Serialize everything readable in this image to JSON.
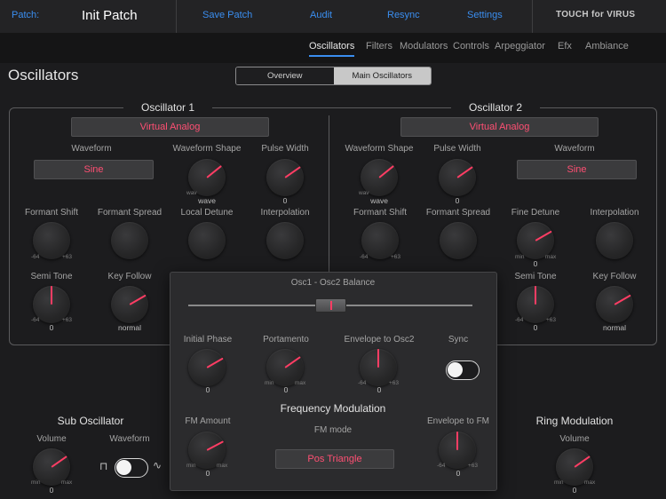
{
  "header": {
    "patch_label": "Patch:",
    "patch_name": "Init Patch",
    "save_patch": "Save Patch",
    "audit": "Audit",
    "resync": "Resync",
    "settings": "Settings",
    "brand": "TOUCH for VIRUS"
  },
  "tabs": [
    "Oscillators",
    "Filters",
    "Modulators",
    "Controls",
    "Arpeggiator",
    "Efx",
    "Ambiance"
  ],
  "page_title": "Oscillators",
  "segmented": {
    "left": "Overview",
    "right": "Main Oscillators",
    "selected": "Main Oscillators"
  },
  "osc1": {
    "title": "Oscillator 1",
    "model": "Virtual Analog",
    "waveform_label": "Waveform",
    "waveform_value": "Sine",
    "wave_shape_label": "Waveform Shape",
    "wave_shape_value": "wave",
    "pulse_width_label": "Pulse Width",
    "pulse_width_value": "0",
    "formant_shift_label": "Formant Shift",
    "formant_spread_label": "Formant Spread",
    "local_detune_label": "Local Detune",
    "interpolation_label": "Interpolation",
    "semi_tone_label": "Semi Tone",
    "semi_tone_value": "0",
    "key_follow_label": "Key Follow",
    "key_follow_value": "normal"
  },
  "osc2": {
    "title": "Oscillator 2",
    "model": "Virtual Analog",
    "wave_shape_label": "Waveform Shape",
    "wave_shape_value": "wave",
    "pulse_width_label": "Pulse Width",
    "pulse_width_value": "0",
    "waveform_label": "Waveform",
    "waveform_value": "Sine",
    "formant_shift_label": "Formant Shift",
    "formant_spread_label": "Formant Spread",
    "fine_detune_label": "Fine Detune",
    "fine_detune_value": "0",
    "interpolation_label": "Interpolation",
    "semi_tone_label": "Semi Tone",
    "semi_tone_value": "0",
    "key_follow_label": "Key Follow",
    "key_follow_value": "normal"
  },
  "popup": {
    "balance_label": "Osc1 - Osc2 Balance",
    "balance_value": 0.5,
    "initial_phase_label": "Initial Phase",
    "initial_phase_value": "0",
    "portamento_label": "Portamento",
    "portamento_value": "0",
    "env_osc2_label": "Envelope to Osc2",
    "env_osc2_value": "0",
    "sync_label": "Sync",
    "sync_on": false,
    "fm_title": "Frequency Modulation",
    "fm_amount_label": "FM Amount",
    "fm_amount_value": "0",
    "fm_mode_label": "FM mode",
    "fm_mode_value": "Pos Triangle",
    "env_fm_label": "Envelope to FM",
    "env_fm_value": "0"
  },
  "sub_osc": {
    "title": "Sub Oscillator",
    "volume_label": "Volume",
    "volume_value": "0",
    "waveform_label": "Waveform",
    "waveform_on": false
  },
  "ring_mod": {
    "title": "Ring Modulation",
    "volume_label": "Volume",
    "volume_value": "0"
  },
  "scale": {
    "min": "min",
    "max": "max",
    "neg64": "-64",
    "pos63": "+63",
    "wav": "wav"
  },
  "colors": {
    "accent": "#ff3d64",
    "link": "#3a8ef0",
    "background": "#1c1c1e",
    "panel": "#2b2b2d"
  }
}
